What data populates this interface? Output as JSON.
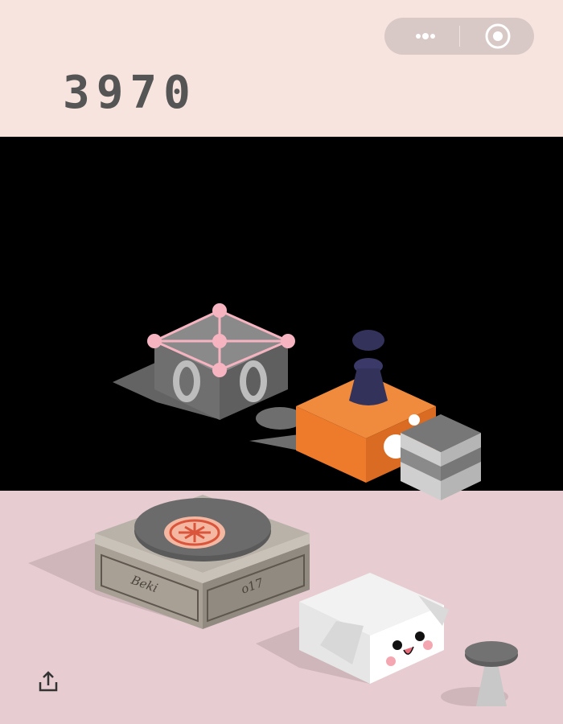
{
  "game": {
    "score": "3970",
    "colors": {
      "top_background": "#f7e4df",
      "void": "#000000",
      "floor": "#e7ccd1",
      "orange_block": "#ee7a2c",
      "wire_cube": "#f6b4c1",
      "player_piece": "#33325a"
    }
  },
  "menu": {
    "more_icon": "more-dots-icon",
    "close_icon": "target-circle-icon"
  },
  "toolbar": {
    "share_icon": "share-icon"
  },
  "blocks": {
    "wooden_box_left_text": "Beki",
    "wooden_box_right_text": "o17"
  }
}
